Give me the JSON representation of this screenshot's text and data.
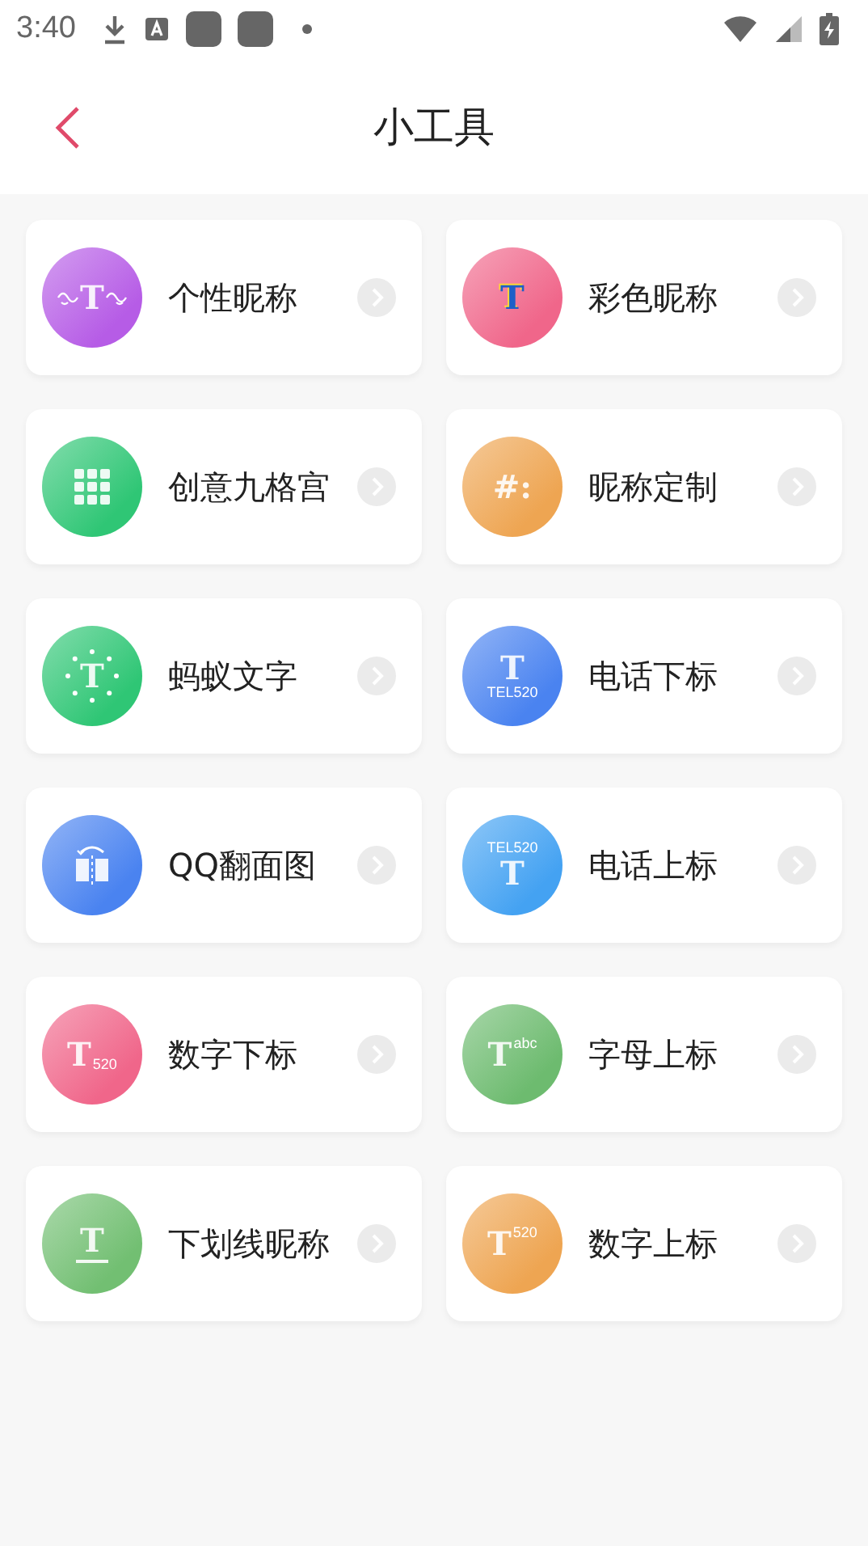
{
  "status_bar": {
    "time": "3:40"
  },
  "header": {
    "title": "小工具"
  },
  "tools": [
    {
      "label": "个性昵称",
      "icon": {
        "kind": "deco",
        "glyph": "T",
        "color": "#b65ce6"
      }
    },
    {
      "label": "彩色昵称",
      "icon": {
        "kind": "rainbow",
        "glyph": "T",
        "color": "#f0668a"
      }
    },
    {
      "label": "创意九格宫",
      "icon": {
        "kind": "grid",
        "color": "#2fc675"
      }
    },
    {
      "label": "昵称定制",
      "icon": {
        "kind": "plain",
        "glyph": "#:",
        "color": "#eea552"
      }
    },
    {
      "label": "蚂蚁文字",
      "icon": {
        "kind": "ant",
        "glyph": "T",
        "color": "#2fc675"
      }
    },
    {
      "label": "电话下标",
      "icon": {
        "kind": "stack_sub",
        "glyph": "T",
        "tag": "TEL520",
        "color": "#4a83f0"
      }
    },
    {
      "label": "QQ翻面图",
      "icon": {
        "kind": "flip",
        "color": "#4a83f0"
      }
    },
    {
      "label": "电话上标",
      "icon": {
        "kind": "stack_sup",
        "glyph": "T",
        "tag": "TEL520",
        "color": "#44a2f2"
      }
    },
    {
      "label": "数字下标",
      "icon": {
        "kind": "sub",
        "glyph": "T",
        "tag": "520",
        "color": "#f0668a"
      }
    },
    {
      "label": "字母上标",
      "icon": {
        "kind": "sup",
        "glyph": "T",
        "tag": "abc",
        "color": "#6dbb6f"
      }
    },
    {
      "label": "下划线昵称",
      "icon": {
        "kind": "underline",
        "glyph": "T",
        "color": "#72bf72"
      }
    },
    {
      "label": "数字上标",
      "icon": {
        "kind": "sup",
        "glyph": "T",
        "tag": "520",
        "color": "#eea552"
      }
    }
  ]
}
